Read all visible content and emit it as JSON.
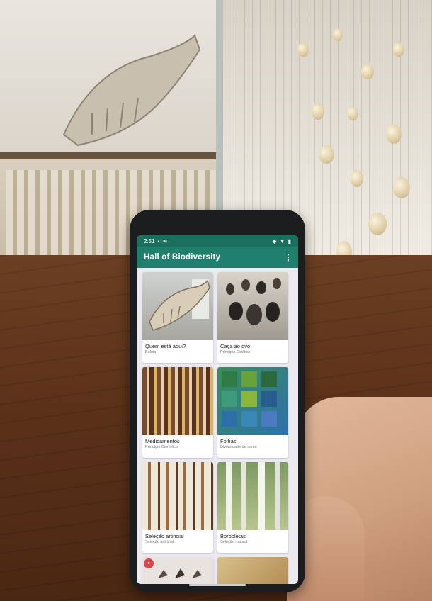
{
  "status_bar": {
    "time": "2:51"
  },
  "app_bar": {
    "title": "Hall of Biodiversity",
    "overflow_glyph": "⋮"
  },
  "cards": [
    {
      "title": "Quem está aqui?",
      "subtitle": "Baleia"
    },
    {
      "title": "Caça ao ovo",
      "subtitle": "Princípio Estético"
    },
    {
      "title": "Medicamentos",
      "subtitle": "Princípio Científico"
    },
    {
      "title": "Folhas",
      "subtitle": "Diversidade de cores"
    },
    {
      "title": "Seleção artificial",
      "subtitle": "Seleção artificial"
    },
    {
      "title": "Borboletas",
      "subtitle": "Seleção natural"
    }
  ],
  "colors": {
    "app_bar": "#1f7f6d",
    "status_bar": "#1a6f5f",
    "screen_bg": "#ece9f1"
  },
  "icons": [
    "overflow-menu-icon",
    "signal-icon",
    "wifi-icon",
    "battery-icon",
    "notification-badge-icon"
  ]
}
